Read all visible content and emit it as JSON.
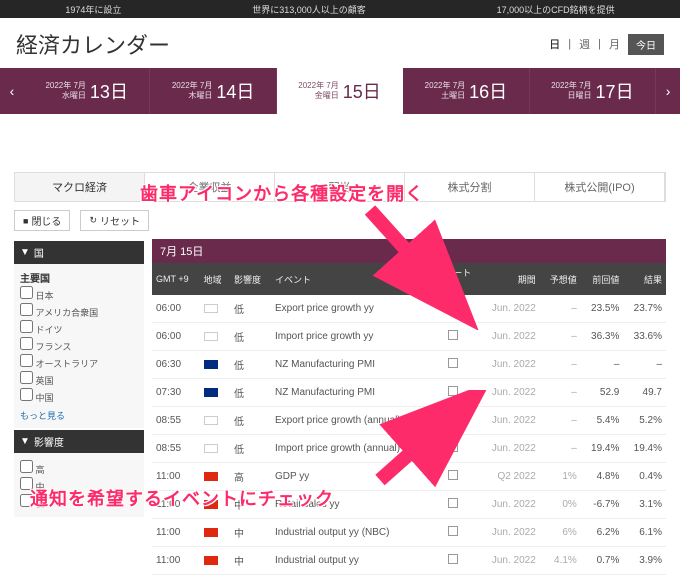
{
  "topbar": {
    "a": "1974年に設立",
    "b": "世界に313,000人以上の顧客",
    "c": "17,000以上のCFD銘柄を提供"
  },
  "title": "経済カレンダー",
  "views": {
    "day": "日",
    "week": "週",
    "month": "月",
    "today": "今日"
  },
  "dates": [
    {
      "y": "2022年 7月",
      "dow": "水曜日",
      "d": "13日"
    },
    {
      "y": "2022年 7月",
      "dow": "木曜日",
      "d": "14日"
    },
    {
      "y": "2022年 7月",
      "dow": "金曜日",
      "d": "15日"
    },
    {
      "y": "2022年 7月",
      "dow": "土曜日",
      "d": "16日"
    },
    {
      "y": "2022年 7月",
      "dow": "日曜日",
      "d": "17日"
    }
  ],
  "tabs": {
    "a": "マクロ経済",
    "b": "企業収益",
    "c": "配当",
    "d": "株式分割",
    "e": "株式公開(IPO)"
  },
  "toolbar": {
    "close": "閉じる",
    "reset": "リセット"
  },
  "side": {
    "country": "国",
    "main_countries": "主要国",
    "countries": [
      "日本",
      "アメリカ合衆国",
      "ドイツ",
      "フランス",
      "オーストラリア",
      "英国",
      "中国"
    ],
    "more": "もっと見る",
    "impact": "影響度",
    "impacts": [
      "高",
      "中",
      "低"
    ]
  },
  "tablehead": {
    "date": "7月 15日",
    "tz": "GMT +9",
    "region": "地域",
    "impact": "影響度",
    "event": "イベント",
    "alert": "アラート",
    "period": "期間",
    "fcst": "予想値",
    "prev": "前回値",
    "res": "結果"
  },
  "rows": [
    {
      "t": "06:00",
      "flag": "kr",
      "imp": "低",
      "ev": "Export price growth yy",
      "per": "Jun. 2022",
      "fc": "–",
      "pv": "23.5%",
      "rs": "23.7%"
    },
    {
      "t": "06:00",
      "flag": "kr",
      "imp": "低",
      "ev": "Import price growth yy",
      "per": "Jun. 2022",
      "fc": "–",
      "pv": "36.3%",
      "rs": "33.6%"
    },
    {
      "t": "06:30",
      "flag": "nz",
      "imp": "低",
      "ev": "NZ Manufacturing PMI",
      "per": "Jun. 2022",
      "fc": "–",
      "pv": "–",
      "rs": "–"
    },
    {
      "t": "07:30",
      "flag": "nz",
      "imp": "低",
      "ev": "NZ Manufacturing PMI",
      "per": "Jun. 2022",
      "fc": "–",
      "pv": "52.9",
      "rs": "49.7"
    },
    {
      "t": "08:55",
      "flag": "kr",
      "imp": "低",
      "ev": "Export price growth (annual)",
      "per": "Jun. 2022",
      "fc": "–",
      "pv": "5.4%",
      "rs": "5.2%"
    },
    {
      "t": "08:55",
      "flag": "kr",
      "imp": "低",
      "ev": "Import price growth (annual)",
      "per": "Jun. 2022",
      "fc": "–",
      "pv": "19.4%",
      "rs": "19.4%"
    },
    {
      "t": "11:00",
      "flag": "cn",
      "imp": "高",
      "ev": "GDP yy",
      "per": "Q2 2022",
      "fc": "1%",
      "pv": "4.8%",
      "rs": "0.4%"
    },
    {
      "t": "11:00",
      "flag": "cn",
      "imp": "中",
      "ev": "Retail sales yy",
      "per": "Jun. 2022",
      "fc": "0%",
      "pv": "-6.7%",
      "rs": "3.1%"
    },
    {
      "t": "11:00",
      "flag": "cn",
      "imp": "中",
      "ev": "Industrial output yy (NBC)",
      "per": "Jun. 2022",
      "fc": "6%",
      "pv": "6.2%",
      "rs": "6.1%"
    },
    {
      "t": "11:00",
      "flag": "cn",
      "imp": "中",
      "ev": "Industrial output yy",
      "per": "Jun. 2022",
      "fc": "4.1%",
      "pv": "0.7%",
      "rs": "3.9%"
    }
  ],
  "annot": {
    "a": "歯車アイコンから各種設定を開く",
    "b": "通知を希望するイベントにチェック"
  }
}
